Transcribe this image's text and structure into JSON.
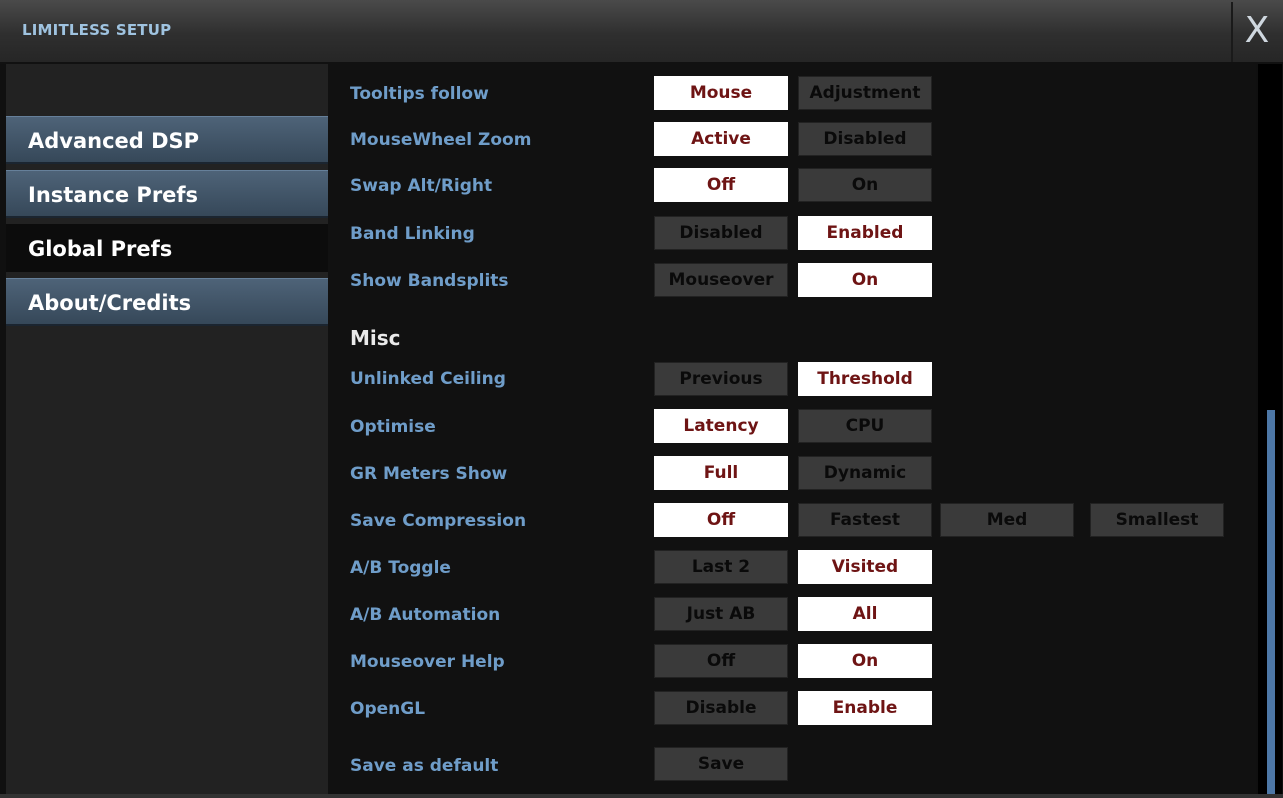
{
  "window": {
    "title": "LIMITLESS SETUP",
    "close_label": "X"
  },
  "sidebar": {
    "items": [
      {
        "label": "Advanced DSP",
        "active": false
      },
      {
        "label": "Instance Prefs",
        "active": false
      },
      {
        "label": "Global Prefs",
        "active": true
      },
      {
        "label": "About/Credits",
        "active": false
      }
    ]
  },
  "settings": {
    "tooltips_follow": {
      "label": "Tooltips follow",
      "options": [
        "Mouse",
        "Adjustment"
      ],
      "selected": "Mouse"
    },
    "mousewheel_zoom": {
      "label": "MouseWheel Zoom",
      "options": [
        "Active",
        "Disabled"
      ],
      "selected": "Active"
    },
    "swap_alt_right": {
      "label": "Swap Alt/Right",
      "options": [
        "Off",
        "On"
      ],
      "selected": "Off"
    },
    "band_linking": {
      "label": "Band Linking",
      "options": [
        "Disabled",
        "Enabled"
      ],
      "selected": "Enabled"
    },
    "show_bandsplits": {
      "label": "Show Bandsplits",
      "options": [
        "Mouseover",
        "On"
      ],
      "selected": "On"
    },
    "misc_title": "Misc",
    "unlinked_ceiling": {
      "label": "Unlinked Ceiling",
      "options": [
        "Previous",
        "Threshold"
      ],
      "selected": "Threshold"
    },
    "optimise": {
      "label": "Optimise",
      "options": [
        "Latency",
        "CPU"
      ],
      "selected": "Latency"
    },
    "gr_meters_show": {
      "label": "GR Meters Show",
      "options": [
        "Full",
        "Dynamic"
      ],
      "selected": "Full"
    },
    "save_compression": {
      "label": "Save Compression",
      "options": [
        "Off",
        "Fastest",
        "Med",
        "Smallest"
      ],
      "selected": "Off"
    },
    "ab_toggle": {
      "label": "A/B Toggle",
      "options": [
        "Last 2",
        "Visited"
      ],
      "selected": "Visited"
    },
    "ab_automation": {
      "label": "A/B Automation",
      "options": [
        "Just AB",
        "All"
      ],
      "selected": "All"
    },
    "mouseover_help": {
      "label": "Mouseover Help",
      "options": [
        "Off",
        "On"
      ],
      "selected": "On"
    },
    "opengl": {
      "label": "OpenGL",
      "options": [
        "Disable",
        "Enable"
      ],
      "selected": "Enable"
    },
    "save_default": {
      "label": "Save as default",
      "button": "Save"
    }
  },
  "colors": {
    "selected_bg": "#ffffff",
    "selected_text": "#6e1414",
    "unselected_bg": "#3a3a3a",
    "label_text": "#6f9dc9",
    "sidebar_bg": "#4e6378"
  }
}
